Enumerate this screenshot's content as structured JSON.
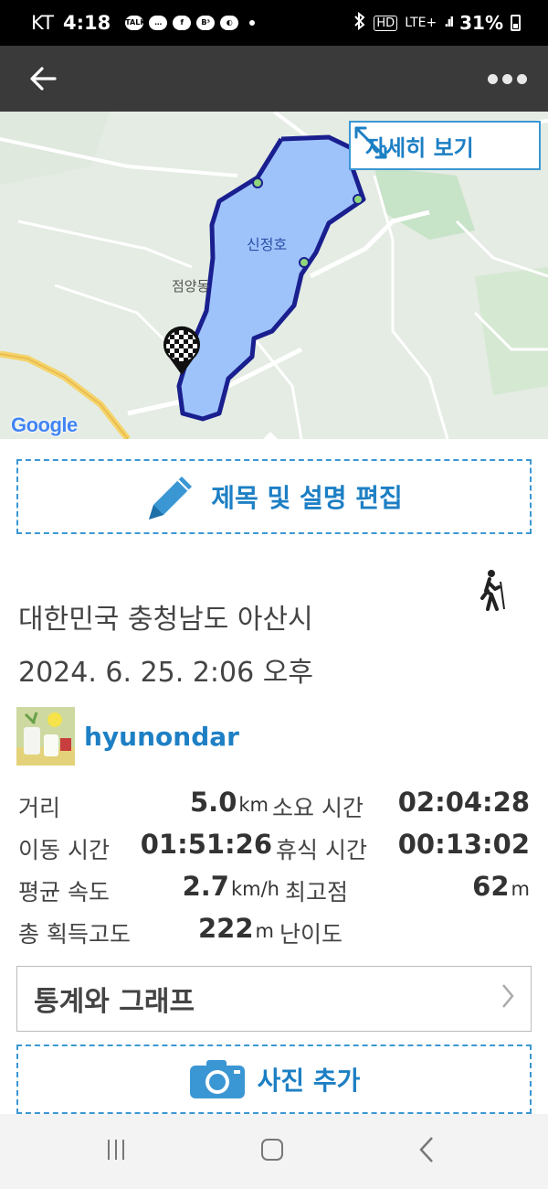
{
  "status_bar": {
    "carrier": "KT",
    "time": "4:18",
    "notifications": [
      "TALK",
      "…",
      "f",
      "B³",
      "◐"
    ],
    "network_hd": "HD",
    "network": "LTE+",
    "battery": "31%"
  },
  "map": {
    "detail_label": "자세히 보기",
    "lake_name": "신정호",
    "place_label": "점양동",
    "attribution": "Google"
  },
  "actions": {
    "edit_label": "제목 및 설명 편집",
    "stats_graph_label": "통계와 그래프",
    "add_photo_label": "사진 추가"
  },
  "activity": {
    "location": "대한민국 충청남도 아산시",
    "datetime": "2024. 6. 25. 2:06 오후",
    "username": "hyunondar",
    "stats": {
      "distance_label": "거리",
      "distance_value": "5.0",
      "distance_unit": "km",
      "duration_label": "소요 시간",
      "duration_value": "02:04:28",
      "moving_time_label": "이동 시간",
      "moving_time_value": "01:51:26",
      "rest_time_label": "휴식 시간",
      "rest_time_value": "00:13:02",
      "avg_speed_label": "평균 속도",
      "avg_speed_value": "2.7",
      "avg_speed_unit": "km/h",
      "max_alt_label": "최고점",
      "max_alt_value": "62",
      "max_alt_unit": "m",
      "total_ascent_label": "총 획득고도",
      "total_ascent_value": "222",
      "total_ascent_unit": "m",
      "difficulty_label": "난이도"
    }
  },
  "colors": {
    "accent": "#1d7fc4",
    "route": "#1a1f8f",
    "lake": "#9ec3fa"
  }
}
